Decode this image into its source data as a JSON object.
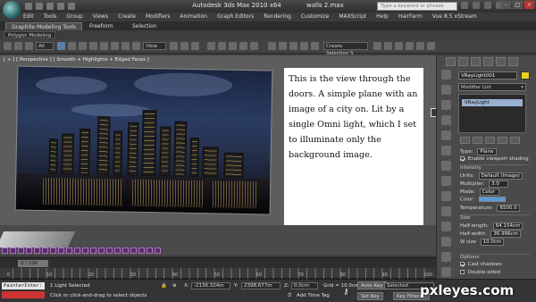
{
  "app": {
    "title": "Autodesk 3ds Max  2010 x64",
    "file": "walls 2.max",
    "search_placeholder": "Type a keyword or phrase"
  },
  "menu": [
    "Edit",
    "Tools",
    "Group",
    "Views",
    "Create",
    "Modifiers",
    "Animation",
    "Graph Editors",
    "Rendering",
    "Customize",
    "MAXScript",
    "Help",
    "HairFarm",
    "Vue 8.5 xStream"
  ],
  "ribbon": {
    "tabs": [
      "Graphite Modeling Tools",
      "Freeform",
      "Selection"
    ],
    "panel": "Polygon Modeling"
  },
  "toolbar": {
    "filter": "All",
    "refcoord": "View",
    "selection_set": "Create Selection S"
  },
  "viewport": {
    "label": "[ + ] [ Perspective ] [ Smooth + Highlights + Edged Faces ]",
    "note_text": "This is the view through the doors.  A simple plane with an image of a city on.  Lit by a single Omni light, which I set to illuminate only the background image."
  },
  "timeline": {
    "frame": "0 / 100",
    "ticks": [
      "0",
      "10",
      "20",
      "30",
      "40",
      "50",
      "60",
      "70",
      "80",
      "90",
      "100"
    ]
  },
  "command_panel": {
    "object_name": "VRayLight001",
    "modifier_list": "Modifier List",
    "stack_item": "VRayLight",
    "type_label": "Type:",
    "type_value": "Plane",
    "enable_viewport_shading": "Enable viewport shading",
    "intensity_header": "Intensity",
    "units_label": "Units:",
    "units_value": "Default (image)",
    "multiplier_label": "Multiplier:",
    "multiplier_value": "3.0",
    "mode_label": "Mode:",
    "mode_value": "Color",
    "color_label": "Color:",
    "temperature_label": "Temperature:",
    "temperature_value": "6500.0",
    "size_header": "Size",
    "half_length_label": "Half-length:",
    "half_length_value": "64.154cm",
    "half_width_label": "Half-width:",
    "half_width_value": "36.996cm",
    "w_size_label": "W size",
    "w_size_value": "10.0cm",
    "options_header": "Options",
    "cast_shadows": "Cast shadows",
    "double_sided": "Double-sided"
  },
  "status": {
    "maxscript": "PainterInter:",
    "selected": "1 Light Selected",
    "prompt": "Click or click-and-drag to select objects",
    "x_label": "X:",
    "x_value": "-2136.324m",
    "y_label": "Y:",
    "y_value": "2398.677m",
    "z_label": "Z:",
    "z_value": "0.0cm",
    "grid": "Grid = 10.0cm",
    "add_time_tag": "Add Time Tag",
    "auto_key": "Auto Key",
    "set_key": "Set Key",
    "selected_drop": "Selected",
    "key_filters": "Key Filters..."
  },
  "watermark": "pxleyes.com",
  "colors": {
    "light_swatch": "#e6d21c",
    "light_color": "#5a9bd6",
    "ui_bg": "#3b3b3b"
  }
}
